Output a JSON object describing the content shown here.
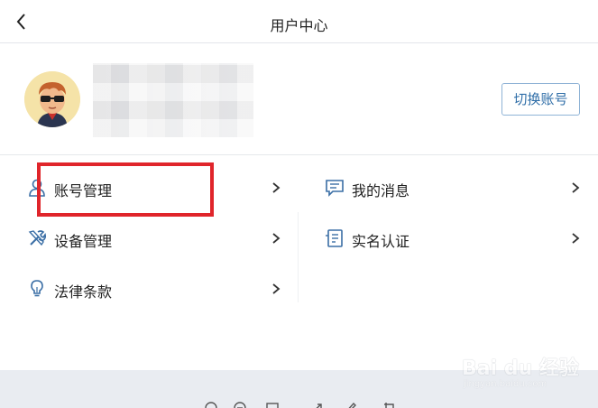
{
  "header": {
    "title": "用户中心",
    "back_icon": "chevron-left-icon"
  },
  "profile": {
    "avatar_icon": "avatar-sunglasses",
    "switch_account_label": "切换账号"
  },
  "menu": {
    "left": [
      {
        "label": "账号管理",
        "icon": "user-icon"
      },
      {
        "label": "设备管理",
        "icon": "tools-icon"
      },
      {
        "label": "法律条款",
        "icon": "lightbulb-icon"
      }
    ],
    "right": [
      {
        "label": "我的消息",
        "icon": "message-icon"
      },
      {
        "label": "实名认证",
        "icon": "id-card-icon"
      }
    ]
  },
  "watermark": {
    "main": "Bai du 经验",
    "sub": "jingyan.baidu.com"
  },
  "colors": {
    "accent_blue": "#2f6ea8",
    "highlight_red": "#e0252b",
    "icon_blue": "#3a6ea5"
  }
}
